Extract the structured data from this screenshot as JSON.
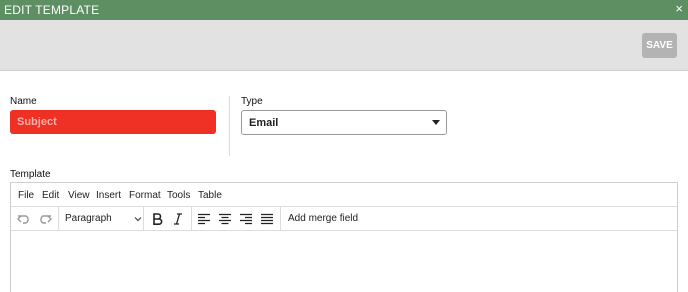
{
  "dialog": {
    "title": "EDIT TEMPLATE",
    "close_glyph": "×",
    "save_label": "SAVE"
  },
  "form": {
    "name_label": "Name",
    "name_placeholder": "Subject",
    "type_label": "Type",
    "type_value": "Email",
    "template_label": "Template"
  },
  "editor": {
    "menu": [
      "File",
      "Edit",
      "View",
      "Insert",
      "Format",
      "Tools",
      "Table"
    ],
    "format_value": "Paragraph",
    "merge_label": "Add merge field"
  },
  "colors": {
    "header": "#5e8f63",
    "error_field": "#ee3124",
    "save_disabled": "#b3b3b3"
  }
}
